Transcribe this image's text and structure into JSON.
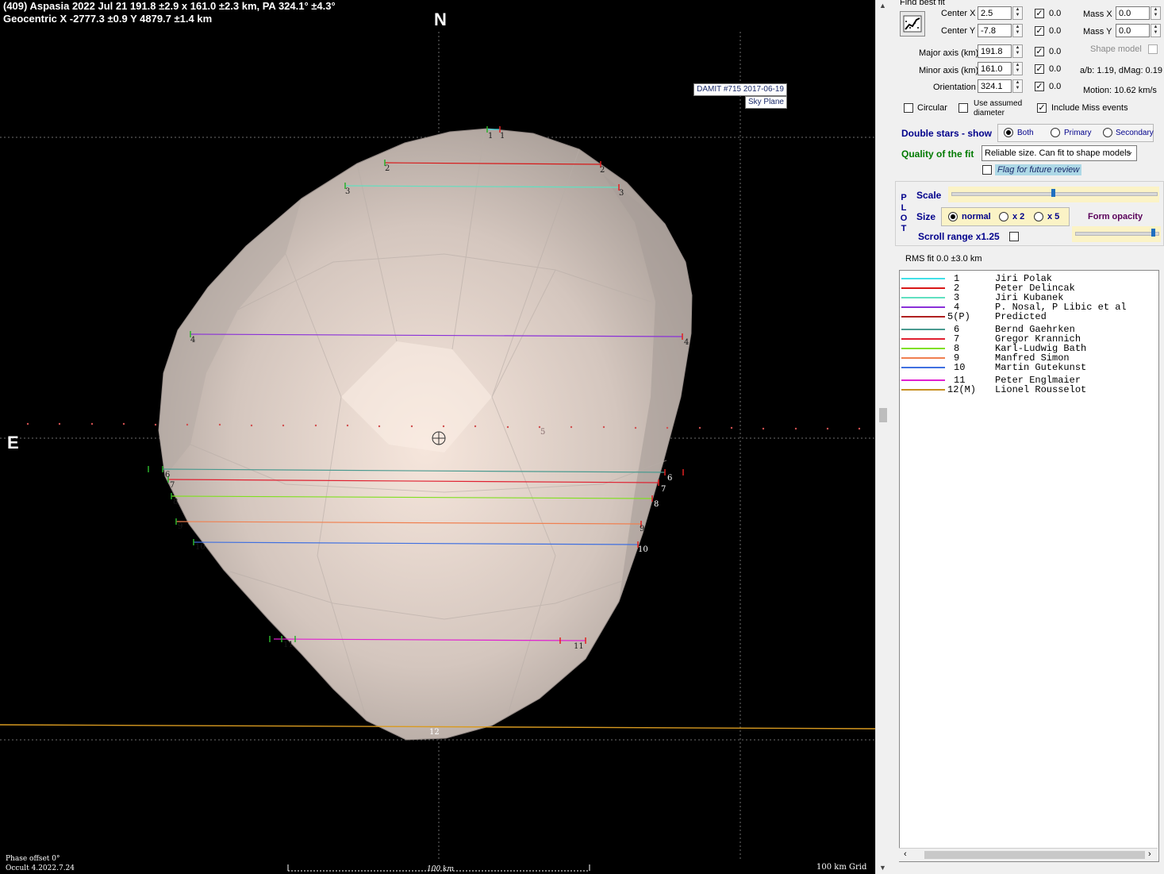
{
  "plot": {
    "title_line1": "(409) Aspasia  2022 Jul 21   191.8 ±2.9 x 161.0 ±2.3 km, PA 324.1° ±4.3°",
    "title_line2": "Geocentric X  -2777.3 ±0.9  Y 4879.7 ±1.4 km",
    "north_label": "N",
    "east_label": "E",
    "damit_label": "DAMIT #715 2017-06-19",
    "sky_plane_label": "Sky Plane",
    "phase_offset": "Phase offset 0°",
    "version": "Occult 4.2022.7.24",
    "scale_bar_label": "100 km",
    "grid_label": "100 km Grid",
    "chord_labels": [
      "1",
      "1",
      "2",
      "2",
      "3",
      "3",
      "4",
      "4",
      "5",
      "6",
      "6",
      "7",
      "7",
      "8",
      "8",
      "9",
      "9",
      "10",
      "10",
      "11",
      "11",
      "12"
    ]
  },
  "panel": {
    "find_best_fit": "Find best fit",
    "center_x_label": "Center X",
    "center_x": "2.5",
    "center_y_label": "Center Y",
    "center_y": "-7.8",
    "mass_x_label": "Mass X",
    "mass_x": "0.0",
    "mass_y_label": "Mass Y",
    "mass_y": "0.0",
    "check_values": [
      "0.0",
      "0.0",
      "0.0",
      "0.0",
      "0.0"
    ],
    "shape_model_label": "Shape model",
    "major_axis_label": "Major axis (km)",
    "major_axis": "191.8",
    "minor_axis_label": "Minor axis (km)",
    "minor_axis": "161.0",
    "orientation_label": "Orientation",
    "orientation": "324.1",
    "ab_dmag": "a/b: 1.19, dMag: 0.19",
    "motion": "Motion: 10.62 km/s",
    "circular_label": "Circular",
    "use_assumed_line1": "Use assumed",
    "use_assumed_line2": "diameter",
    "include_miss_label": "Include Miss events",
    "double_stars_label": "Double stars - show",
    "ds_both": "Both",
    "ds_primary": "Primary",
    "ds_secondary": "Secondary",
    "quality_label": "Quality of the fit",
    "quality_value": "Reliable size. Can fit to shape models",
    "flag_label": "Flag for future review",
    "plot_vertical": [
      "P",
      "L",
      "O",
      "T"
    ],
    "scale_label": "Scale",
    "size_label": "Size",
    "size_normal": "normal",
    "size_x2": "x 2",
    "size_x5": "x 5",
    "form_opacity_label": "Form opacity",
    "scroll_range_label": "Scroll range x1.25",
    "rms_fit": "RMS fit 0.0 ±3.0 km"
  },
  "legend": [
    {
      "index": "1",
      "name": "Jiri Polak",
      "color": "#40e0e8"
    },
    {
      "index": "2",
      "name": "Peter Delincak",
      "color": "#d81818"
    },
    {
      "index": "3",
      "name": "Jiri Kubanek",
      "color": "#60e0c0"
    },
    {
      "index": "4",
      "name": "P. Nosal, P Libic et al",
      "color": "#8a30d8"
    },
    {
      "index": "5(P)",
      "name": "Predicted",
      "color": "#b02020"
    },
    {
      "index": "6",
      "name": "Bernd Gaehrken",
      "color": "#4a9a90"
    },
    {
      "index": "7",
      "name": "Gregor Krannich",
      "color": "#e02030"
    },
    {
      "index": "8",
      "name": "Karl-Ludwig Bath",
      "color": "#80e020"
    },
    {
      "index": "9",
      "name": "Manfred Simon",
      "color": "#f08050"
    },
    {
      "index": "10",
      "name": "Martin Gutekunst",
      "color": "#4070e0"
    },
    {
      "index": "11",
      "name": "Peter Englmaier",
      "color": "#e020d0"
    },
    {
      "index": "12(M)",
      "name": "Lionel Rousselot",
      "color": "#c89020"
    }
  ],
  "colors": {
    "asteroid_light": "#f3e2d8",
    "asteroid_mid": "#cdbfb8",
    "asteroid_dark": "#9a908b",
    "grid": "#6e6e6e",
    "miss_line": "#d89a20"
  }
}
